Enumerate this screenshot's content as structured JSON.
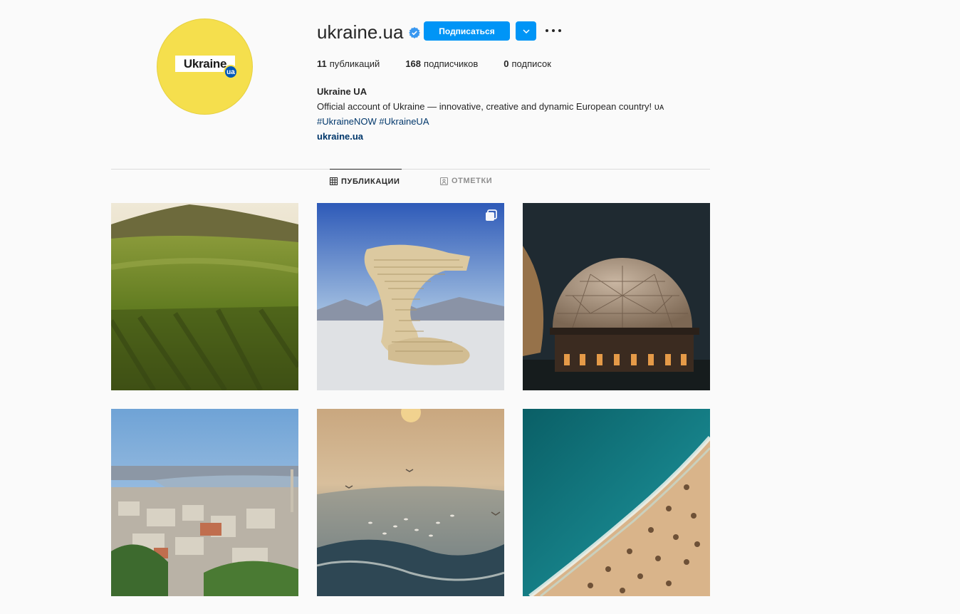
{
  "profile": {
    "username": "ukraine.ua",
    "avatar_text": "Ukraine",
    "avatar_badge": "ua",
    "follow_label": "Подписаться",
    "stats": {
      "posts_count": "11",
      "posts_label": "публикаций",
      "followers_count": "168",
      "followers_label": "подписчиков",
      "following_count": "0",
      "following_label": "подписок"
    },
    "bio": {
      "name": "Ukraine UA",
      "description": "Official account of Ukraine — innovative, creative and dynamic European country! ᴜᴀ",
      "hashtags": "#UkraineNOW #UkraineUA",
      "website": "ukraine.ua"
    }
  },
  "tabs": [
    {
      "label": "ПУБЛИКАЦИИ",
      "icon": "grid-icon",
      "active": true
    },
    {
      "label": "ОТМЕТКИ",
      "icon": "tagged-icon",
      "active": false
    }
  ],
  "posts": [
    {
      "subject": "vineyard-hills",
      "multi": false
    },
    {
      "subject": "wooden-hand-sculpture",
      "multi": true
    },
    {
      "subject": "observatory-dome-night",
      "multi": false
    },
    {
      "subject": "kyiv-cityscape",
      "multi": false
    },
    {
      "subject": "sea-sunset-gulls",
      "multi": false
    },
    {
      "subject": "beach-aerial",
      "multi": false
    }
  ],
  "colors": {
    "accent": "#0095f6",
    "verified": "#3897f0",
    "link": "#00376b",
    "avatar_bg": "#f5df4d"
  }
}
